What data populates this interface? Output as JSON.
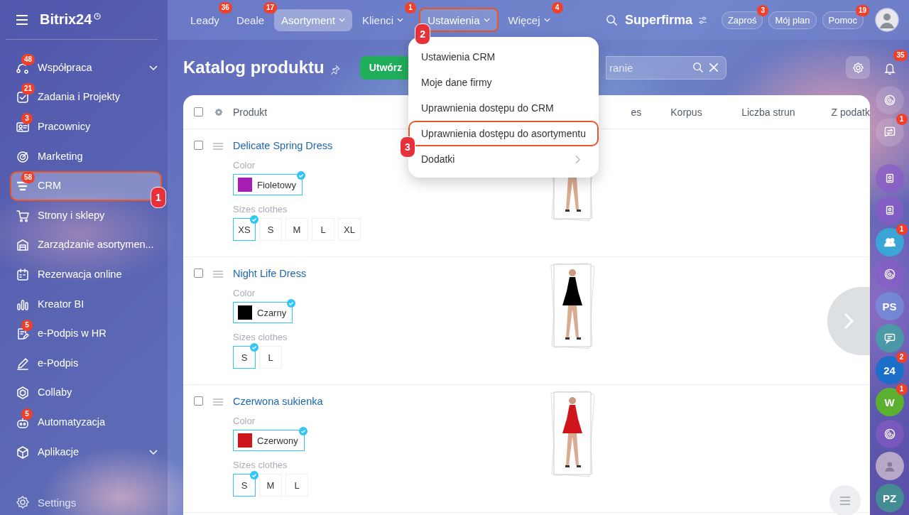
{
  "sidebar": {
    "logo": "Bitrix24",
    "items": [
      {
        "label": "Współpraca",
        "badge": "48",
        "expandable": true,
        "selected": false
      },
      {
        "label": "Zadania i Projekty",
        "badge": "21",
        "expandable": false,
        "selected": false
      },
      {
        "label": "Pracownicy",
        "badge": "3",
        "expandable": false,
        "selected": false
      },
      {
        "label": "Marketing",
        "expandable": false,
        "selected": false
      },
      {
        "label": "CRM",
        "badge": "58",
        "expandable": false,
        "selected": true,
        "callout": "1"
      },
      {
        "label": "Strony i sklepy",
        "expandable": false,
        "selected": false
      },
      {
        "label": "Zarządzanie asortymen...",
        "expandable": false,
        "selected": false
      },
      {
        "label": "Rezerwacja online",
        "expandable": false,
        "selected": false
      },
      {
        "label": "Kreator BI",
        "expandable": false,
        "selected": false
      },
      {
        "label": "e-Podpis w HR",
        "badge": "5",
        "expandable": false,
        "selected": false
      },
      {
        "label": "e-Podpis",
        "expandable": false,
        "selected": false
      },
      {
        "label": "Collaby",
        "expandable": false,
        "selected": false
      },
      {
        "label": "Automatyzacja",
        "badge": "5",
        "expandable": false,
        "selected": false
      },
      {
        "label": "Aplikacje",
        "expandable": true,
        "selected": false
      }
    ],
    "settings": "Settings"
  },
  "topbar": {
    "tabs": [
      {
        "label": "Leady",
        "badge": "36",
        "dropdown": false,
        "selected": false
      },
      {
        "label": "Deale",
        "badge": "17",
        "dropdown": false,
        "selected": false
      },
      {
        "label": "Asortyment",
        "dropdown": true,
        "selected": true
      },
      {
        "label": "Klienci",
        "badge": "1",
        "dropdown": true,
        "selected": false
      },
      {
        "label": "Ustawienia",
        "dropdown": true,
        "selected": false,
        "callout": "2"
      },
      {
        "label": "Więcej",
        "badge": "4",
        "dropdown": true,
        "selected": false
      }
    ],
    "company": "Superfirma",
    "buttons": [
      {
        "label": "Zaproś",
        "badge": "3"
      },
      {
        "label": "Mój plan"
      },
      {
        "label": "Pomoc",
        "badge": "19"
      }
    ]
  },
  "page": {
    "title": "Katalog produktu",
    "create_button": "Utwórz",
    "search": {
      "placeholder": "ranie"
    }
  },
  "menu": {
    "items": [
      {
        "label": "Ustawienia CRM",
        "submenu": false,
        "selected": false
      },
      {
        "label": "Moje dane firmy",
        "submenu": false,
        "selected": false
      },
      {
        "label": "Uprawnienia dostępu do CRM",
        "submenu": false,
        "selected": false
      },
      {
        "label": "Uprawnienia dostępu do asortymentu",
        "submenu": false,
        "selected": true,
        "callout": "3"
      },
      {
        "label": "Dodatki",
        "submenu": true,
        "selected": false
      }
    ]
  },
  "table": {
    "header_checked": false,
    "columns": [
      "Produkt",
      "es",
      "Korpus",
      "Liczba strun",
      "Z podatk"
    ],
    "rows": [
      {
        "checked": false,
        "name": "Delicate Spring Dress",
        "color_label": "Color",
        "color": {
          "label": "Fioletowy",
          "color": "#a61db4"
        },
        "sizes_label": "Sizes clothes",
        "sizes": [
          {
            "label": "XS",
            "selected": true
          },
          {
            "label": "S",
            "selected": false
          },
          {
            "label": "M",
            "selected": false
          },
          {
            "label": "L",
            "selected": false
          },
          {
            "label": "XL",
            "selected": false
          }
        ]
      },
      {
        "checked": false,
        "name": "Night Life Dress",
        "color_label": "Color",
        "color": {
          "label": "Czarny",
          "color": "#000000"
        },
        "sizes_label": "Sizes clothes",
        "sizes": [
          {
            "label": "S",
            "selected": true
          },
          {
            "label": "L",
            "selected": false
          }
        ]
      },
      {
        "checked": false,
        "name": "Czerwona sukienka",
        "color_label": "Color",
        "color": {
          "label": "Czerwony",
          "color": "#d0141b"
        },
        "sizes_label": "Sizes clothes",
        "sizes": [
          {
            "label": "S",
            "selected": true
          },
          {
            "label": "M",
            "selected": false
          },
          {
            "label": "L",
            "selected": false
          }
        ]
      }
    ]
  },
  "rail": [
    {
      "kind": "icon",
      "badge": "35"
    },
    {
      "kind": "icon"
    },
    {
      "kind": "icon",
      "badge": "1"
    },
    {
      "kind": "icon"
    },
    {
      "kind": "icon"
    },
    {
      "kind": "icon",
      "badge": "1"
    },
    {
      "kind": "icon"
    },
    {
      "kind": "initials",
      "text": "PS"
    },
    {
      "kind": "icon"
    },
    {
      "kind": "initials",
      "text": "24",
      "badge": "2"
    },
    {
      "kind": "initials",
      "text": "W",
      "badge": "1"
    },
    {
      "kind": "icon"
    },
    {
      "kind": "avatar"
    },
    {
      "kind": "initials",
      "text": "PZ"
    }
  ]
}
